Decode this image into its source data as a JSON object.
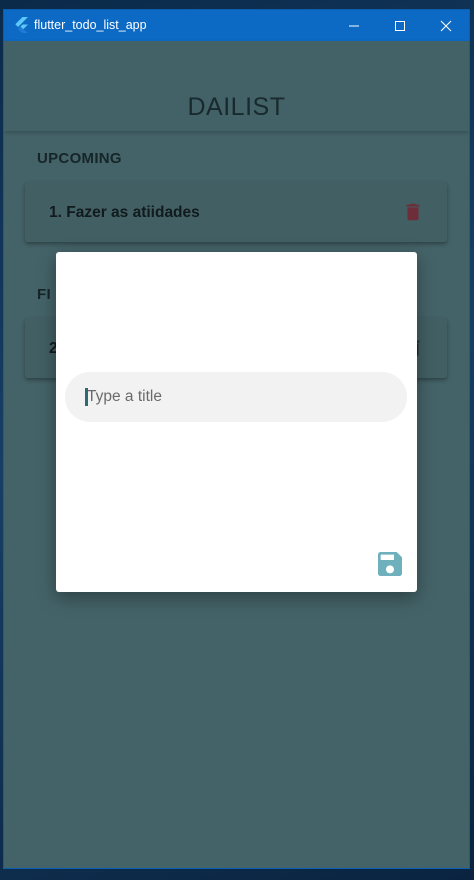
{
  "window": {
    "title": "flutter_todo_list_app",
    "icon": "flutter-logo-icon"
  },
  "app": {
    "title": "DAILIST"
  },
  "sections": {
    "upcoming": {
      "label": "UPCOMING",
      "tasks": [
        {
          "text": "1. Fazer as atiidades",
          "delete_icon": "trash-icon"
        }
      ]
    },
    "finished": {
      "label": "FI",
      "tasks": [
        {
          "text": "2",
          "delete_icon": "trash-icon"
        }
      ]
    }
  },
  "dialog": {
    "title_input": {
      "placeholder": "Type a title",
      "value": ""
    },
    "save_icon": "save-icon"
  },
  "colors": {
    "titlebar": "#0c69c4",
    "accent": "#4d949e",
    "delete": "#8a3a4a"
  }
}
